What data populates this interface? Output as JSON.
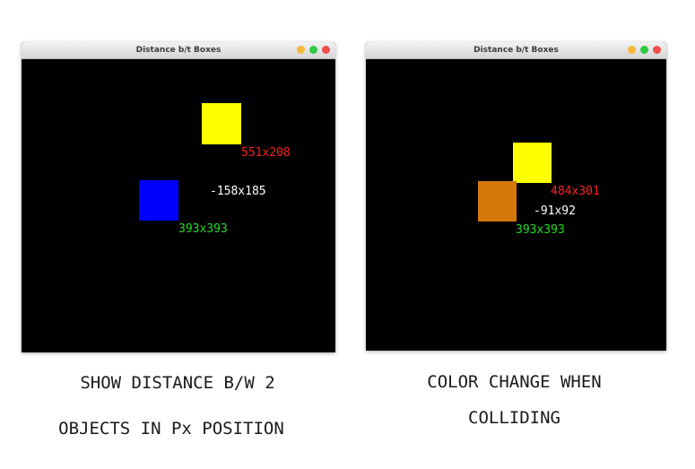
{
  "left_window": {
    "title": "Distance b/t Boxes",
    "yellow_box": {
      "color": "#ffff00",
      "position_label": "551x208",
      "label_color": "#ff2020"
    },
    "blue_box": {
      "color": "#0000ff",
      "position_label": "393x393",
      "label_color": "#22dd22"
    },
    "distance_label": "-158x185",
    "distance_color": "#ffffff"
  },
  "right_window": {
    "title": "Distance b/t Boxes",
    "yellow_box": {
      "color": "#ffff00",
      "position_label": "484x301",
      "label_color": "#ff2020"
    },
    "orange_box": {
      "color": "#d4780c",
      "position_label": "393x393",
      "label_color": "#22dd22"
    },
    "distance_label": "-91x92",
    "distance_color": "#ffffff"
  },
  "window_controls": {
    "minimize_color": "#f5b93a",
    "maximize_color": "#2fcb41",
    "close_color": "#ee4f4a"
  },
  "captions": {
    "left_line1": "SHOW DISTANCE B/W 2",
    "left_line2": "OBJECTS IN Px POSITION",
    "right_line1": "COLOR CHANGE WHEN",
    "right_line2": "COLLIDING"
  }
}
